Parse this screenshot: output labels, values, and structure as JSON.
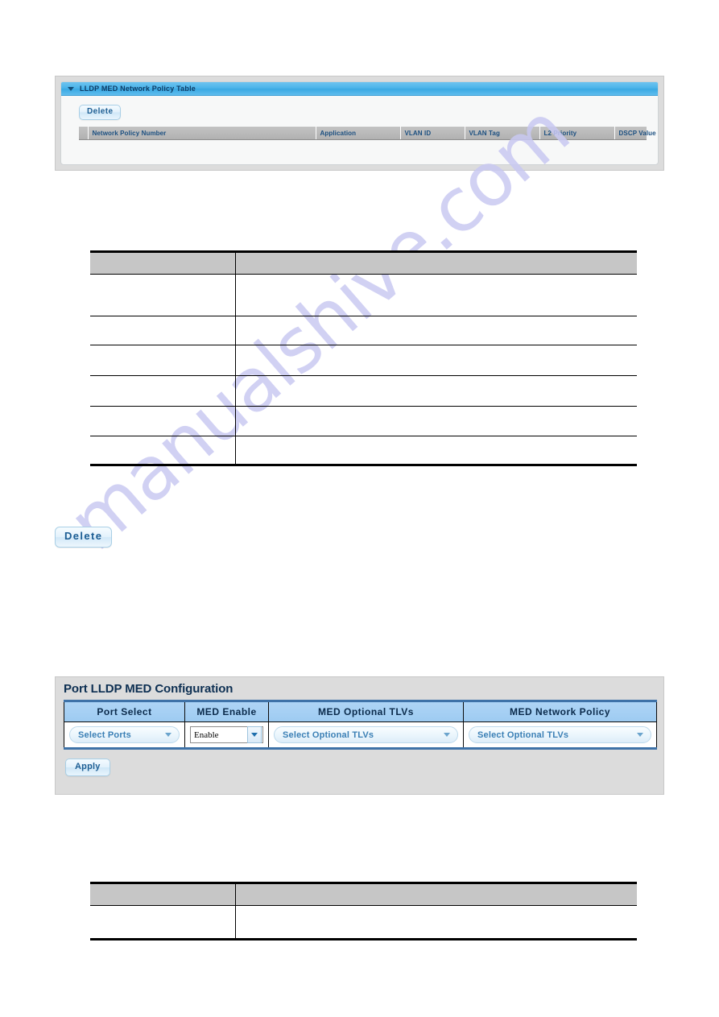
{
  "watermark": {
    "text": "manualshive.com"
  },
  "policy_panel": {
    "header_title": "LLDP MED Network Policy Table",
    "collapse_icon": "caret-down-icon",
    "delete_label": "Delete",
    "columns": [
      "Network Policy Number",
      "Application",
      "VLAN ID",
      "VLAN Tag",
      "L2 Priority",
      "DSCP Value"
    ],
    "rows": []
  },
  "spec_table_1": {
    "headers": [
      "",
      ""
    ],
    "rows": [
      [
        "",
        ""
      ],
      [
        "",
        ""
      ],
      [
        "",
        ""
      ],
      [
        "",
        ""
      ],
      [
        "",
        ""
      ],
      [
        "",
        ""
      ]
    ]
  },
  "delete_figure": {
    "label": "Delete"
  },
  "config_panel": {
    "title": "Port LLDP MED Configuration",
    "columns": [
      "Port Select",
      "MED Enable",
      "MED Optional TLVs",
      "MED Network Policy"
    ],
    "fields": {
      "port_select": {
        "value": "Select Ports",
        "icon": "chevron-down-icon"
      },
      "med_enable": {
        "value": "Enable",
        "icon": "chevron-down-icon"
      },
      "med_optional_tlvs": {
        "value": "Select Optional TLVs",
        "icon": "chevron-down-icon"
      },
      "med_network_policy": {
        "value": "Select Optional TLVs",
        "icon": "chevron-down-icon"
      }
    },
    "apply_label": "Apply"
  },
  "spec_table_2": {
    "headers": [
      "",
      ""
    ],
    "rows": [
      [
        "",
        ""
      ]
    ]
  }
}
